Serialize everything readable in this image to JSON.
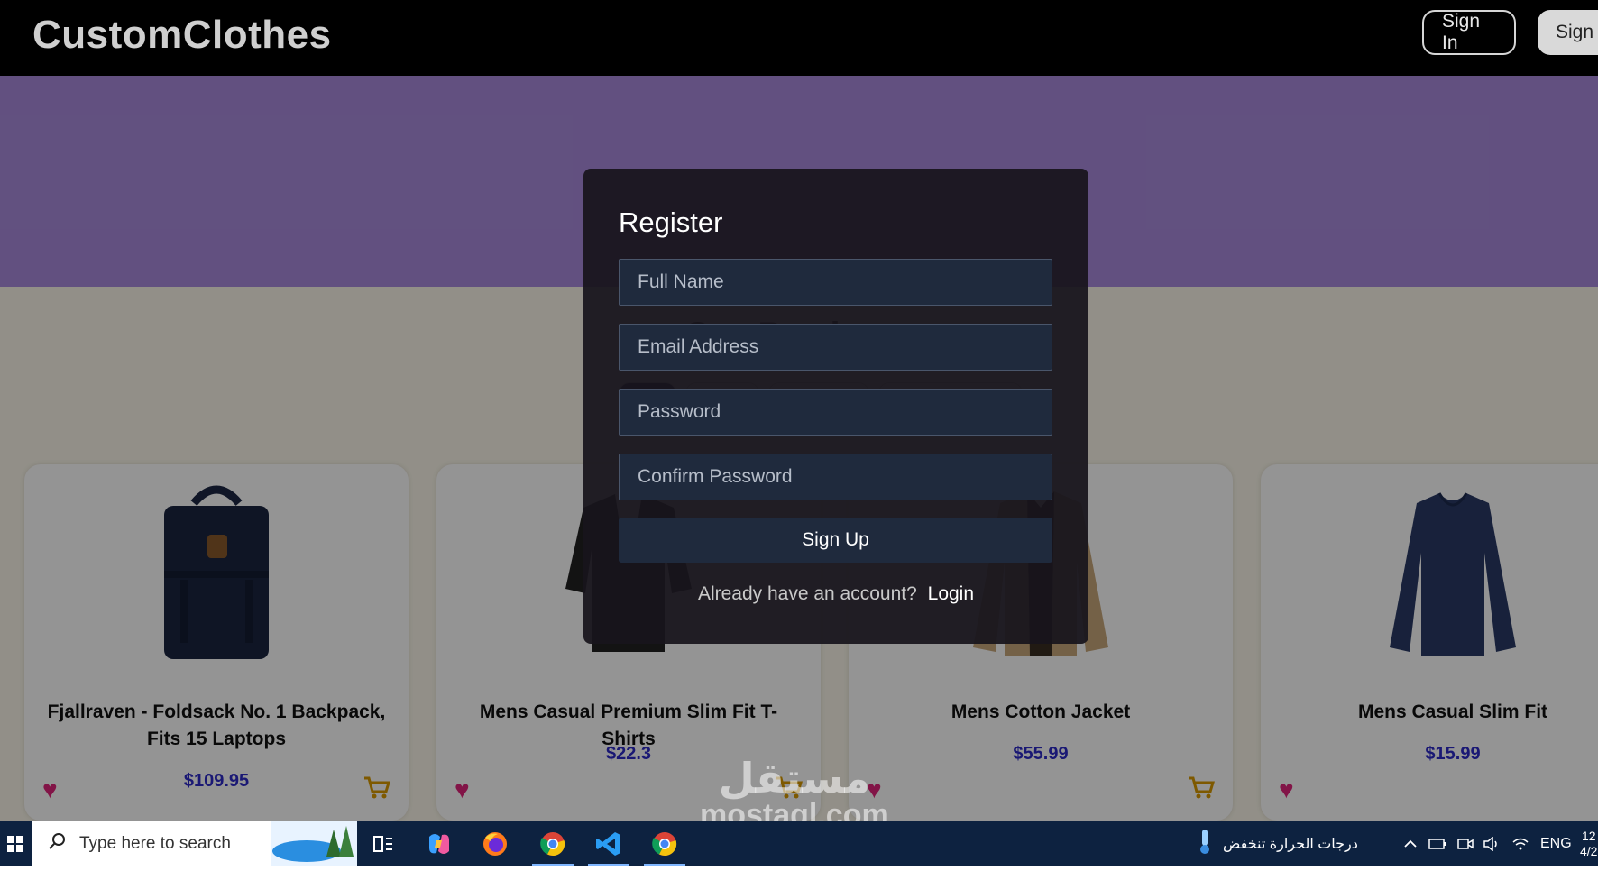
{
  "header": {
    "brand": "CustomClothes",
    "signin_label": "Sign In",
    "signup_label": "Sign Up"
  },
  "section": {
    "title": "Our Products"
  },
  "products": [
    {
      "title": "Fjallraven - Foldsack No. 1 Backpack, Fits 15 Laptops",
      "price": "$109.95"
    },
    {
      "title": "Mens Casual Premium Slim Fit T-Shirts",
      "price": "$22.3"
    },
    {
      "title": "Mens Cotton Jacket",
      "price": "$55.99"
    },
    {
      "title": "Mens Casual Slim Fit",
      "price": "$15.99"
    }
  ],
  "modal": {
    "title": "Register",
    "fullname_placeholder": "Full Name",
    "email_placeholder": "Email Address",
    "password_placeholder": "Password",
    "confirm_placeholder": "Confirm Password",
    "submit_label": "Sign Up",
    "switch_text": "Already have an account?",
    "login_label": "Login"
  },
  "watermark": {
    "arabic": "مستقل",
    "latin": "mostaql.com"
  },
  "taskbar": {
    "search_placeholder": "Type here to search",
    "weather_text": "درجات الحرارة تنخفض",
    "language": "ENG",
    "clock_time": "12",
    "clock_date": "4/2"
  },
  "colors": {
    "accent_purple": "#a98bdc",
    "price_blue": "#2d2ac9",
    "heart_pink": "#e0247a",
    "cart_gold": "#d99a00",
    "input_bg": "#1f2a3d"
  }
}
